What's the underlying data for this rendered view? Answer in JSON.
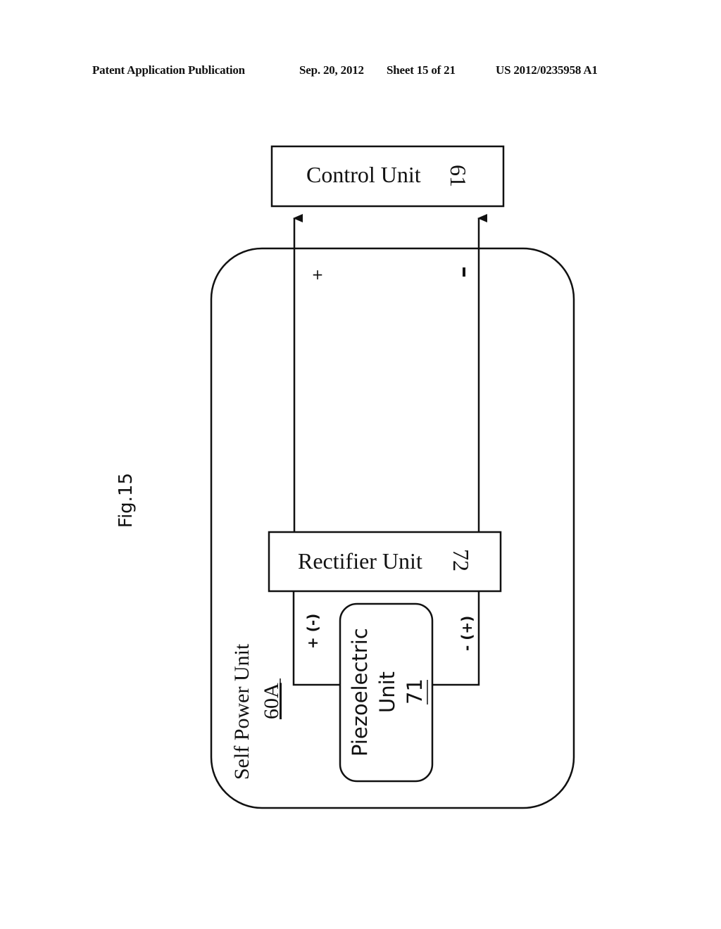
{
  "header": {
    "publication": "Patent Application Publication",
    "date": "Sep. 20, 2012",
    "sheet": "Sheet 15 of 21",
    "number": "US 2012/0235958 A1"
  },
  "figure": {
    "label": "Fig.15"
  },
  "blocks": {
    "control_unit": {
      "name": "Control Unit",
      "ref": "61"
    },
    "self_power_unit": {
      "name": "Self Power Unit",
      "ref": "60A"
    },
    "rectifier_unit": {
      "name": "Rectifier Unit",
      "ref": "72"
    },
    "piezoelectric_unit": {
      "line1": "Piezoelectric",
      "line2": "Unit",
      "ref": "71"
    }
  },
  "polarity": {
    "output_left": "+",
    "output_right": "-",
    "input_left": "+ (-)",
    "input_right": "- (+)"
  }
}
